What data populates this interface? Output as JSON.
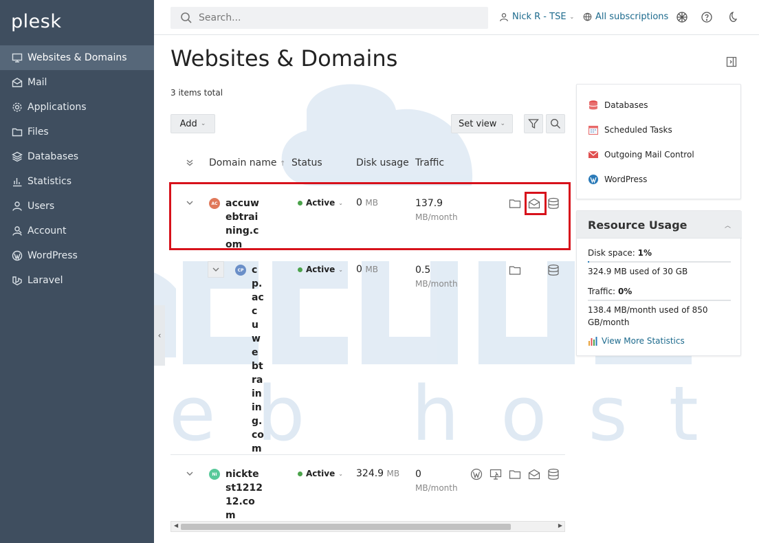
{
  "app": {
    "logo": "plesk"
  },
  "sidebar": {
    "items": [
      {
        "label": "Websites & Domains",
        "icon": "monitor-icon",
        "active": true
      },
      {
        "label": "Mail",
        "icon": "mail-icon"
      },
      {
        "label": "Applications",
        "icon": "gear-icon"
      },
      {
        "label": "Files",
        "icon": "folder-icon"
      },
      {
        "label": "Databases",
        "icon": "database-icon"
      },
      {
        "label": "Statistics",
        "icon": "chart-icon"
      },
      {
        "label": "Users",
        "icon": "user-icon"
      },
      {
        "label": "Account",
        "icon": "account-icon"
      },
      {
        "label": "WordPress",
        "icon": "wordpress-icon"
      },
      {
        "label": "Laravel",
        "icon": "laravel-icon"
      }
    ]
  },
  "header": {
    "search_placeholder": "Search...",
    "user": "Nick R - TSE",
    "subscriptions": "All subscriptions"
  },
  "page": {
    "title": "Websites & Domains",
    "total": "3 items total"
  },
  "toolbar": {
    "add_label": "Add",
    "set_view_label": "Set view"
  },
  "table": {
    "columns": [
      "Domain name",
      "Status",
      "Disk usage",
      "Traffic"
    ],
    "rows": [
      {
        "avatar": "AC",
        "avatar_color": "#e0785a",
        "domain": "accuwebtraining.com",
        "status": "Active",
        "disk_value": "0",
        "disk_unit": "MB",
        "traffic_value": "137.9",
        "traffic_unit": "MB/month",
        "highlighted": true
      },
      {
        "avatar": "CP",
        "avatar_color": "#6a8fc8",
        "domain": "cp.accuwebtraining.com",
        "status": "Active",
        "disk_value": "0",
        "disk_unit": "MB",
        "traffic_value": "0.5",
        "traffic_unit": "MB/month"
      },
      {
        "avatar": "NI",
        "avatar_color": "#58c99a",
        "domain": "nicktest121212.com",
        "status": "Active",
        "disk_value": "324.9",
        "disk_unit": "MB",
        "traffic_value": "0",
        "traffic_unit": "MB/month"
      }
    ]
  },
  "tools": [
    {
      "label": "Databases",
      "icon": "database-icon",
      "color": "#e04848"
    },
    {
      "label": "Scheduled Tasks",
      "icon": "calendar-icon",
      "color": "#e86a6a"
    },
    {
      "label": "Outgoing Mail Control",
      "icon": "mail-icon",
      "color": "#e05050"
    },
    {
      "label": "WordPress",
      "icon": "wordpress-icon",
      "color": "#2a7ab8"
    }
  ],
  "resource_usage": {
    "title": "Resource Usage",
    "disk_label": "Disk space:",
    "disk_percent": "1%",
    "disk_fraction": 0.01,
    "disk_detail": "324.9 MB used of 30 GB",
    "traffic_label": "Traffic:",
    "traffic_percent": "0%",
    "traffic_fraction": 0.0,
    "traffic_detail": "138.4 MB/month used of 850 GB/month",
    "link": "View More Statistics"
  },
  "colors": {
    "sidebar": "#3f4e5f",
    "link": "#1c6a8d",
    "highlight": "#d7111b",
    "status_active": "#4ba34b"
  }
}
